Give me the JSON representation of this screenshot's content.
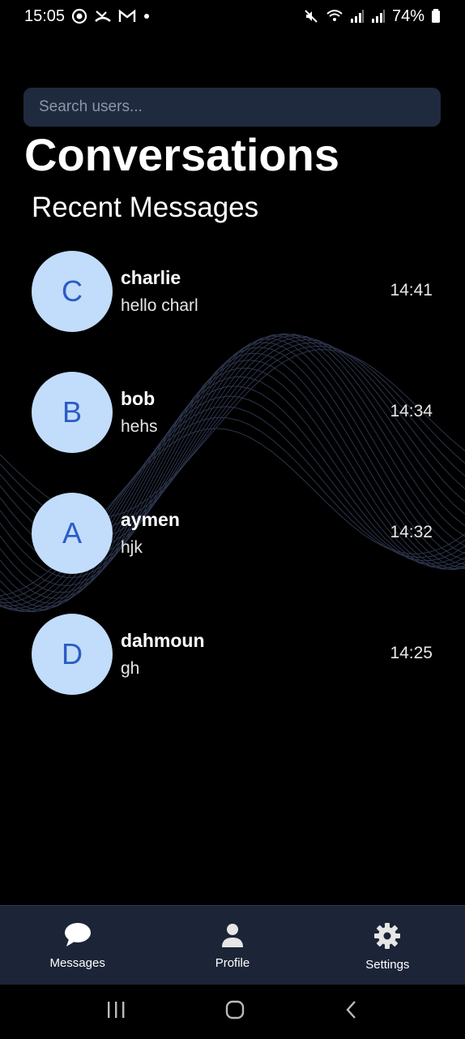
{
  "status_bar": {
    "time": "15:05",
    "battery": "74%",
    "left_icons": [
      "whatsapp-icon",
      "missed-call-icon",
      "gmail-icon",
      "dot-icon"
    ],
    "right_icons": [
      "mute-icon",
      "wifi-icon",
      "signal-icon",
      "signal-icon",
      "battery-icon"
    ]
  },
  "search": {
    "placeholder": "Search users..."
  },
  "header": {
    "title": "Conversations",
    "subtitle": "Recent Messages"
  },
  "conversations": [
    {
      "initial": "C",
      "name": "charlie",
      "preview": "hello charl",
      "time": "14:41"
    },
    {
      "initial": "B",
      "name": "bob",
      "preview": "hehs",
      "time": "14:34"
    },
    {
      "initial": "A",
      "name": "aymen",
      "preview": "hjk",
      "time": "14:32"
    },
    {
      "initial": "D",
      "name": "dahmoun",
      "preview": "gh",
      "time": "14:25"
    }
  ],
  "tabs": [
    {
      "label": "Messages",
      "icon": "chat-bubble-icon"
    },
    {
      "label": "Profile",
      "icon": "person-icon"
    },
    {
      "label": "Settings",
      "icon": "gear-icon"
    }
  ],
  "colors": {
    "background": "#000000",
    "search_bg": "#1f2a3e",
    "avatar_bg": "#c2dcfb",
    "avatar_text": "#2b5cc4",
    "tabbar_bg": "#1c2537"
  }
}
